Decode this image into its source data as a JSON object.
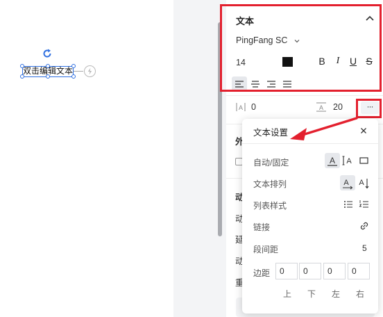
{
  "canvas": {
    "text_box": "双击编辑文本"
  },
  "panel": {
    "section_title": "文本",
    "font_family": "PingFang SC",
    "font_size": "14",
    "text_color": "#111111",
    "format_buttons": [
      "B",
      "I",
      "U",
      "S"
    ],
    "letter_spacing": "0",
    "line_height": "20",
    "more_label": "···",
    "partial_labels": [
      "外",
      "动",
      "动",
      "延",
      "动",
      "重"
    ]
  },
  "popover": {
    "title": "文本设置",
    "rows": {
      "auto_fixed": "自动/固定",
      "arrangement": "文本排列",
      "list_style": "列表样式",
      "link": "链接",
      "paragraph_spacing": "段间距",
      "paragraph_spacing_value": "5",
      "margin": "边距"
    },
    "margins": [
      "0",
      "0",
      "0",
      "0"
    ],
    "margin_labels": [
      "上",
      "下",
      "左",
      "右"
    ]
  },
  "colors": {
    "highlight": "#e3202e",
    "selection": "#2f6fe0",
    "arrow": "#e3202e"
  }
}
